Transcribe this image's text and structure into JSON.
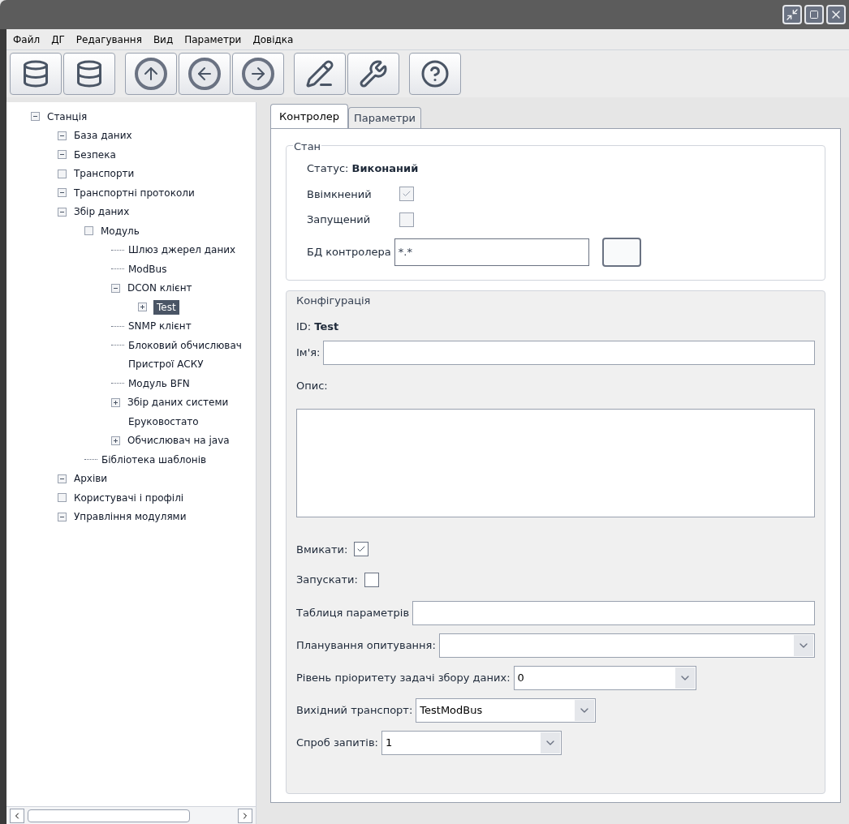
{
  "menu": [
    "Файл",
    "ДГ",
    "Редагування",
    "Вид",
    "Параметри",
    "Довідка"
  ],
  "toolbar": [
    {
      "kind": "db-up"
    },
    {
      "kind": "db-down"
    },
    {
      "kind": "up"
    },
    {
      "kind": "back"
    },
    {
      "kind": "forward"
    },
    {
      "kind": "edit"
    },
    {
      "kind": "tool"
    },
    {
      "kind": "help"
    }
  ],
  "tree": [
    {
      "label": "Станція",
      "kind": "minus",
      "selected": false,
      "children": [
        {
          "label": "База даних",
          "kind": "minus",
          "selected": false
        },
        {
          "label": "Безпека",
          "kind": "minus",
          "selected": false
        },
        {
          "label": "Транспорти",
          "kind": "empty",
          "selected": false
        },
        {
          "label": "Транспортні протоколи",
          "kind": "minus",
          "selected": false
        },
        {
          "label": "Збір даних",
          "kind": "minus",
          "selected": false,
          "children": [
            {
              "label": "Модуль",
              "kind": "empty",
              "selected": false,
              "children": [
                {
                  "label": "Шлюз джерел даних",
                  "kind": "leaf",
                  "selected": false
                },
                {
                  "label": "ModBus",
                  "kind": "leaf",
                  "selected": false
                },
                {
                  "label": "DCON клієнт",
                  "kind": "minus",
                  "selected": false,
                  "children": [
                    {
                      "label": "Test",
                      "kind": "plus",
                      "selected": true
                    }
                  ]
                },
                {
                  "label": "SNMP клієнт",
                  "kind": "leaf",
                  "selected": false
                },
                {
                  "label": "Блоковий обчислювач",
                  "kind": "leaf",
                  "selected": false
                },
                {
                  "label": "Пристрої АСКУ",
                  "kind": "none",
                  "selected": false
                },
                {
                  "label": "Модуль BFN",
                  "kind": "leaf",
                  "selected": false
                },
                {
                  "label": "Збір даних системи",
                  "kind": "plus",
                  "selected": false
                },
                {
                  "label": "Еруковостато",
                  "kind": "none",
                  "selected": false
                },
                {
                  "label": "Обчислювач на java",
                  "kind": "plus",
                  "selected": false
                }
              ]
            },
            {
              "label": "Бібліотека шаблонів",
              "kind": "leaf",
              "selected": false
            }
          ]
        },
        {
          "label": "Архіви",
          "kind": "minus",
          "selected": false
        },
        {
          "label": "Користувачі і профілі",
          "kind": "empty",
          "selected": false
        },
        {
          "label": "Управління модулями",
          "kind": "minus",
          "selected": false
        }
      ]
    }
  ],
  "tabs": [
    {
      "label": "Контролер",
      "selected": true
    },
    {
      "label": "Параметри",
      "selected": false
    }
  ],
  "state_group": {
    "title": "Стан",
    "status": "Статус: **Виконаний**",
    "checks": [
      {
        "label": "Ввімкнений",
        "checked": true,
        "disabled": true
      },
      {
        "label": "Запущений",
        "checked": false,
        "disabled": true
      }
    ],
    "db_label": "БД контролера",
    "db_value": "*.*"
  },
  "config_group": {
    "title": "Конфігурація",
    "id": "ID: **Test**",
    "name_label": "Ім'я:",
    "description_label": "Опис:",
    "checks": [
      {
        "label": "Вмикати:",
        "checked": true
      },
      {
        "label": "Запускати:",
        "checked": false
      }
    ],
    "fields": [
      {
        "kind": "text",
        "label": "Таблиця параметрів"
      },
      {
        "kind": "combo",
        "label": "Планування опитування:"
      },
      {
        "kind": "combo",
        "label": "Рівень пріоритету задачі збору даних:",
        "value": "0"
      },
      {
        "kind": "combo",
        "label": "Вихідний транспорт:",
        "value": "TestModBus"
      },
      {
        "kind": "combo",
        "label": "Спроб запитів:",
        "value": "1"
      }
    ]
  }
}
